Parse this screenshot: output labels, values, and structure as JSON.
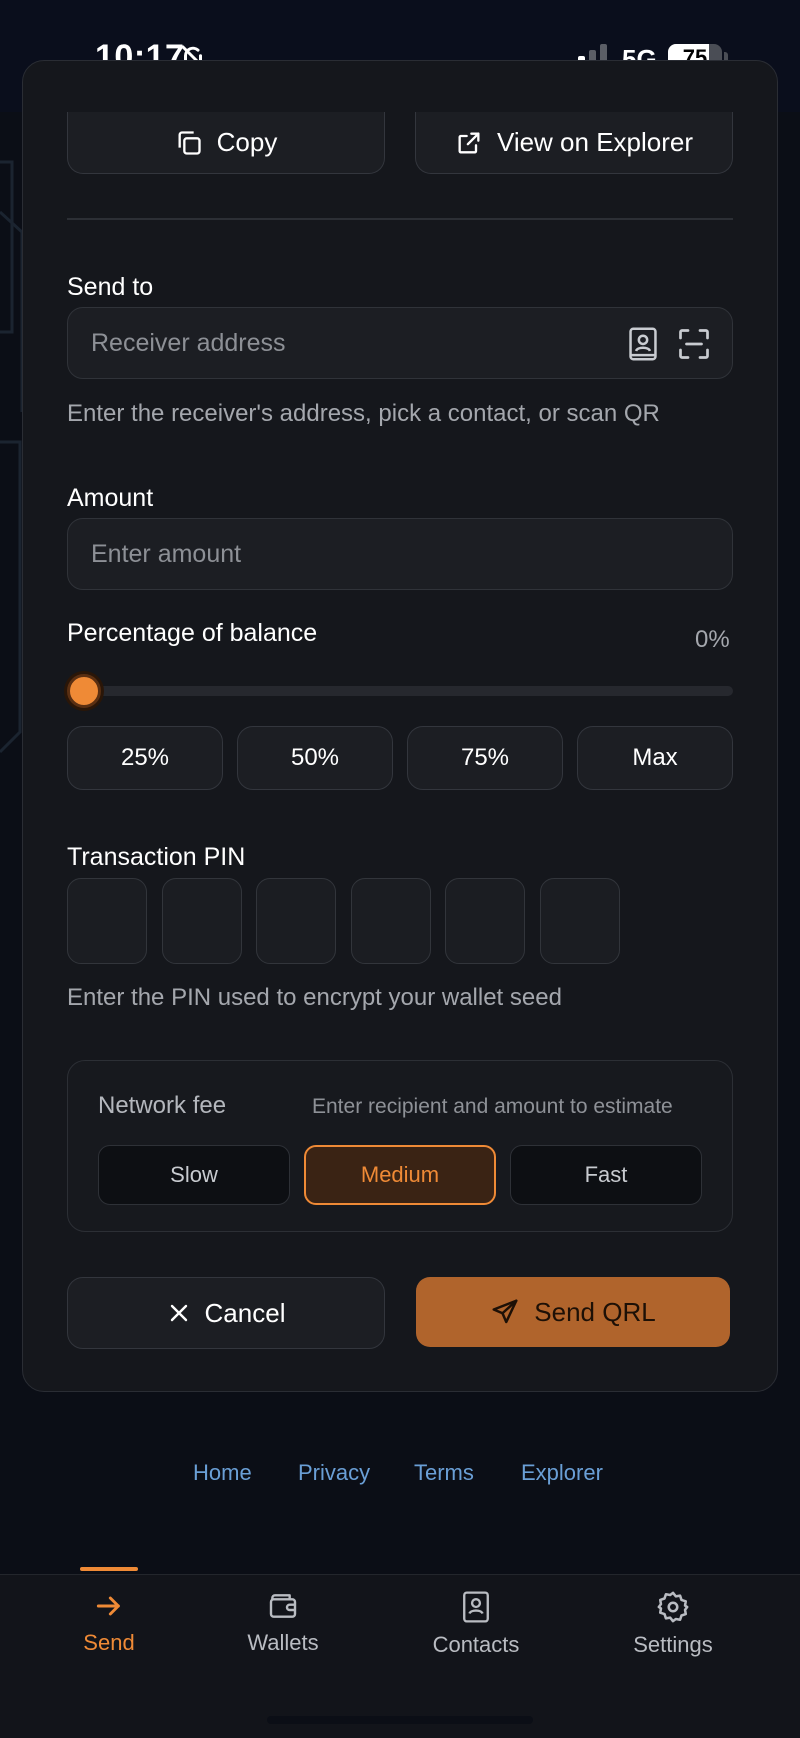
{
  "status_bar": {
    "time": "10:17",
    "network": "5G",
    "battery": "75",
    "battery_level": 0.75
  },
  "top_actions": {
    "copy_label": "Copy",
    "explorer_label": "View on Explorer"
  },
  "send_to": {
    "label": "Send to",
    "placeholder": "Receiver address",
    "hint": "Enter the receiver's address, pick a contact, or scan QR"
  },
  "amount": {
    "label": "Amount",
    "placeholder": "Enter amount"
  },
  "percentage": {
    "label": "Percentage of balance",
    "value": "0%",
    "level": 0,
    "presets": [
      "25%",
      "50%",
      "75%",
      "Max"
    ]
  },
  "pin": {
    "label": "Transaction PIN",
    "length": 6,
    "hint": "Enter the PIN used to encrypt your wallet seed"
  },
  "network_fee": {
    "label": "Network fee",
    "estimate": "Enter recipient and amount to estimate",
    "options": [
      "Slow",
      "Medium",
      "Fast"
    ],
    "selected": "Medium"
  },
  "actions": {
    "cancel_label": "Cancel",
    "send_label": "Send QRL"
  },
  "footer_links": [
    "Home",
    "Privacy",
    "Terms",
    "Explorer"
  ],
  "bottom_nav": [
    {
      "label": "Send",
      "icon": "arrow-right-icon",
      "active": true
    },
    {
      "label": "Wallets",
      "icon": "wallet-icon",
      "active": false
    },
    {
      "label": "Contacts",
      "icon": "contact-book-icon",
      "active": false
    },
    {
      "label": "Settings",
      "icon": "gear-icon",
      "active": false
    }
  ],
  "colors": {
    "accent": "#ef8a36",
    "background": "#0b0e16",
    "card": "#15171c",
    "link": "#6a9fd6"
  }
}
